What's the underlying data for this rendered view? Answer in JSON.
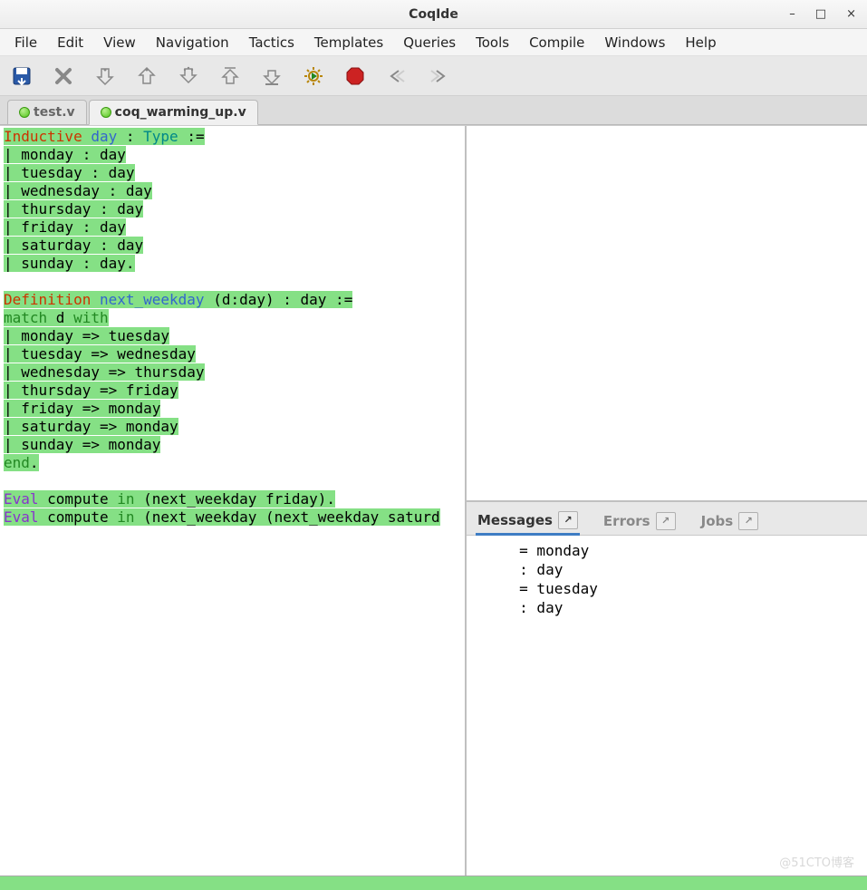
{
  "title": "CoqIde",
  "window_controls": {
    "min": "–",
    "max": "□",
    "close": "×"
  },
  "menu": [
    "File",
    "Edit",
    "View",
    "Navigation",
    "Tactics",
    "Templates",
    "Queries",
    "Tools",
    "Compile",
    "Windows",
    "Help"
  ],
  "toolbar_icons": [
    "save",
    "close-doc",
    "forward-one",
    "back-one",
    "forward-line",
    "back-line",
    "to-cursor",
    "gear-run",
    "stop",
    "undo-focus",
    "next-focus"
  ],
  "tabs": [
    {
      "label": "test.v",
      "active": false
    },
    {
      "label": "coq_warming_up.v",
      "active": true
    }
  ],
  "code_lines": [
    [
      {
        "t": "Inductive",
        "c": "kw-red"
      },
      {
        "t": " "
      },
      {
        "t": "day",
        "c": "kw-blue"
      },
      {
        "t": " : "
      },
      {
        "t": "Type",
        "c": "kw-teal"
      },
      {
        "t": " :="
      }
    ],
    [
      {
        "t": "| monday : day"
      }
    ],
    [
      {
        "t": "| tuesday : day"
      }
    ],
    [
      {
        "t": "| wednesday : day"
      }
    ],
    [
      {
        "t": "| thursday : day"
      }
    ],
    [
      {
        "t": "| friday : day"
      }
    ],
    [
      {
        "t": "| saturday : day"
      }
    ],
    [
      {
        "t": "| sunday : day."
      }
    ],
    [],
    [
      {
        "t": "Definition",
        "c": "kw-red"
      },
      {
        "t": " "
      },
      {
        "t": "next_weekday",
        "c": "kw-blue"
      },
      {
        "t": " (d:day) : day :="
      }
    ],
    [
      {
        "t": "match",
        "c": "kw-green"
      },
      {
        "t": " d "
      },
      {
        "t": "with",
        "c": "kw-green"
      }
    ],
    [
      {
        "t": "| monday => tuesday"
      }
    ],
    [
      {
        "t": "| tuesday => wednesday"
      }
    ],
    [
      {
        "t": "| wednesday => thursday"
      }
    ],
    [
      {
        "t": "| thursday => friday"
      }
    ],
    [
      {
        "t": "| friday => monday"
      }
    ],
    [
      {
        "t": "| saturday => monday"
      }
    ],
    [
      {
        "t": "| sunday => monday"
      }
    ],
    [
      {
        "t": "end",
        "c": "kw-green"
      },
      {
        "t": "."
      }
    ],
    [],
    [
      {
        "t": "Eval",
        "c": "kw-purple"
      },
      {
        "t": " compute "
      },
      {
        "t": "in",
        "c": "kw-green"
      },
      {
        "t": " (next_weekday friday)."
      }
    ],
    [
      {
        "t": "Eval",
        "c": "kw-purple"
      },
      {
        "t": " compute "
      },
      {
        "t": "in",
        "c": "kw-green"
      },
      {
        "t": " (next_weekday (next_weekday saturd"
      }
    ]
  ],
  "output_tabs": [
    {
      "label": "Messages",
      "active": true
    },
    {
      "label": "Errors",
      "active": false
    },
    {
      "label": "Jobs",
      "active": false
    }
  ],
  "messages": "     = monday\n     : day\n     = tuesday\n     : day",
  "watermark": "@51CTO博客"
}
